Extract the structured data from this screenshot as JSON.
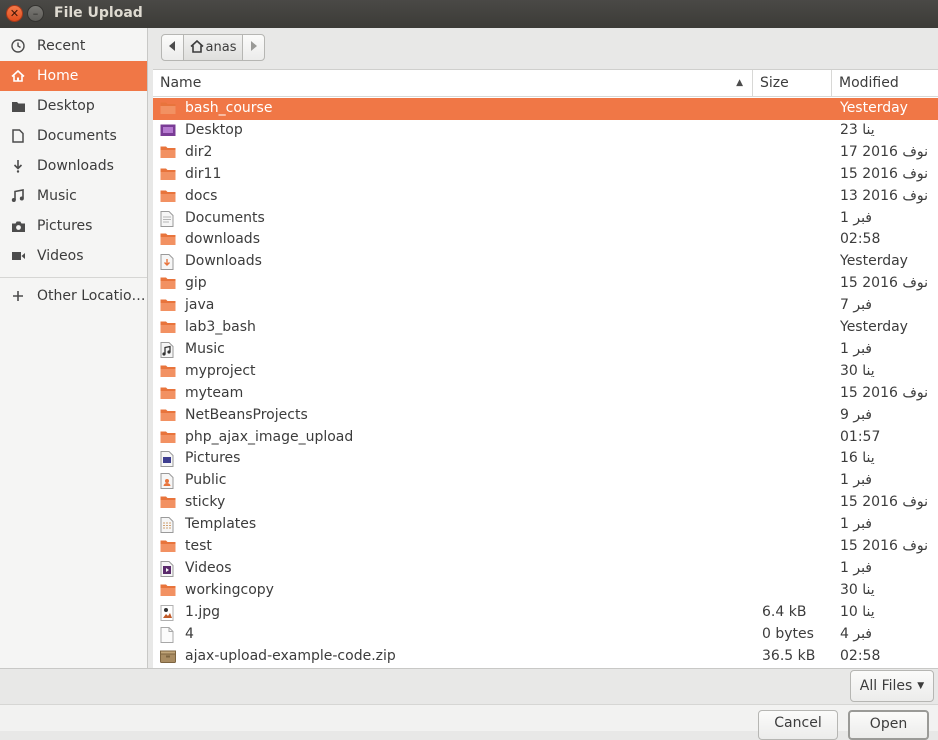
{
  "window": {
    "title": "File Upload"
  },
  "sidebar": {
    "items": [
      {
        "label": "Recent",
        "icon": "clock-icon",
        "active": false
      },
      {
        "label": "Home",
        "icon": "home-icon",
        "active": true
      },
      {
        "label": "Desktop",
        "icon": "folder-icon",
        "active": false
      },
      {
        "label": "Documents",
        "icon": "document-icon",
        "active": false
      },
      {
        "label": "Downloads",
        "icon": "download-icon",
        "active": false
      },
      {
        "label": "Music",
        "icon": "music-icon",
        "active": false
      },
      {
        "label": "Pictures",
        "icon": "camera-icon",
        "active": false
      },
      {
        "label": "Videos",
        "icon": "video-icon",
        "active": false
      }
    ],
    "other": {
      "label": "Other Locatio…",
      "icon": "plus-icon"
    }
  },
  "pathbar": {
    "current": "anas"
  },
  "columns": {
    "name": "Name",
    "size": "Size",
    "modified": "Modified"
  },
  "files": [
    {
      "name": "bash_course",
      "size": "",
      "modified": "Yesterday",
      "type": "folder",
      "selected": true
    },
    {
      "name": "Desktop",
      "size": "",
      "modified": "23 ينا",
      "type": "desktop-folder"
    },
    {
      "name": "dir2",
      "size": "",
      "modified": "17 نوف 2016",
      "type": "folder"
    },
    {
      "name": "dir11",
      "size": "",
      "modified": "15 نوف 2016",
      "type": "folder"
    },
    {
      "name": "docs",
      "size": "",
      "modified": "13 نوف 2016",
      "type": "folder"
    },
    {
      "name": "Documents",
      "size": "",
      "modified": "1 فبر",
      "type": "documents-folder"
    },
    {
      "name": "downloads",
      "size": "",
      "modified": "02:58",
      "type": "folder"
    },
    {
      "name": "Downloads",
      "size": "",
      "modified": "Yesterday",
      "type": "downloads-folder"
    },
    {
      "name": "gip",
      "size": "",
      "modified": "15 نوف 2016",
      "type": "folder"
    },
    {
      "name": "java",
      "size": "",
      "modified": "7 فبر",
      "type": "folder"
    },
    {
      "name": "lab3_bash",
      "size": "",
      "modified": "Yesterday",
      "type": "folder"
    },
    {
      "name": "Music",
      "size": "",
      "modified": "1 فبر",
      "type": "music-folder"
    },
    {
      "name": "myproject",
      "size": "",
      "modified": "30 ينا",
      "type": "folder"
    },
    {
      "name": "myteam",
      "size": "",
      "modified": "15 نوف 2016",
      "type": "folder"
    },
    {
      "name": "NetBeansProjects",
      "size": "",
      "modified": "9 فبر",
      "type": "folder"
    },
    {
      "name": "php_ajax_image_upload",
      "size": "",
      "modified": "01:57",
      "type": "folder"
    },
    {
      "name": "Pictures",
      "size": "",
      "modified": "16 ينا",
      "type": "pictures-folder"
    },
    {
      "name": "Public",
      "size": "",
      "modified": "1 فبر",
      "type": "public-folder"
    },
    {
      "name": "sticky",
      "size": "",
      "modified": "15 نوف 2016",
      "type": "folder"
    },
    {
      "name": "Templates",
      "size": "",
      "modified": "1 فبر",
      "type": "templates-folder"
    },
    {
      "name": "test",
      "size": "",
      "modified": "15 نوف 2016",
      "type": "folder"
    },
    {
      "name": "Videos",
      "size": "",
      "modified": "1 فبر",
      "type": "videos-folder"
    },
    {
      "name": "workingcopy",
      "size": "",
      "modified": "30 ينا",
      "type": "folder"
    },
    {
      "name": "1.jpg",
      "size": "6.4 kB",
      "modified": "10 ينا",
      "type": "image-file"
    },
    {
      "name": "4",
      "size": "0 bytes",
      "modified": "4 فبر",
      "type": "blank-file"
    },
    {
      "name": "ajax-upload-example-code.zip",
      "size": "36.5 kB",
      "modified": "02:58",
      "type": "archive-file"
    }
  ],
  "filter": {
    "label": "All Files"
  },
  "buttons": {
    "cancel": "Cancel",
    "open": "Open"
  },
  "colors": {
    "accent": "#f07746",
    "titlebar": "#3c3b37",
    "folder": "#e8743c"
  }
}
